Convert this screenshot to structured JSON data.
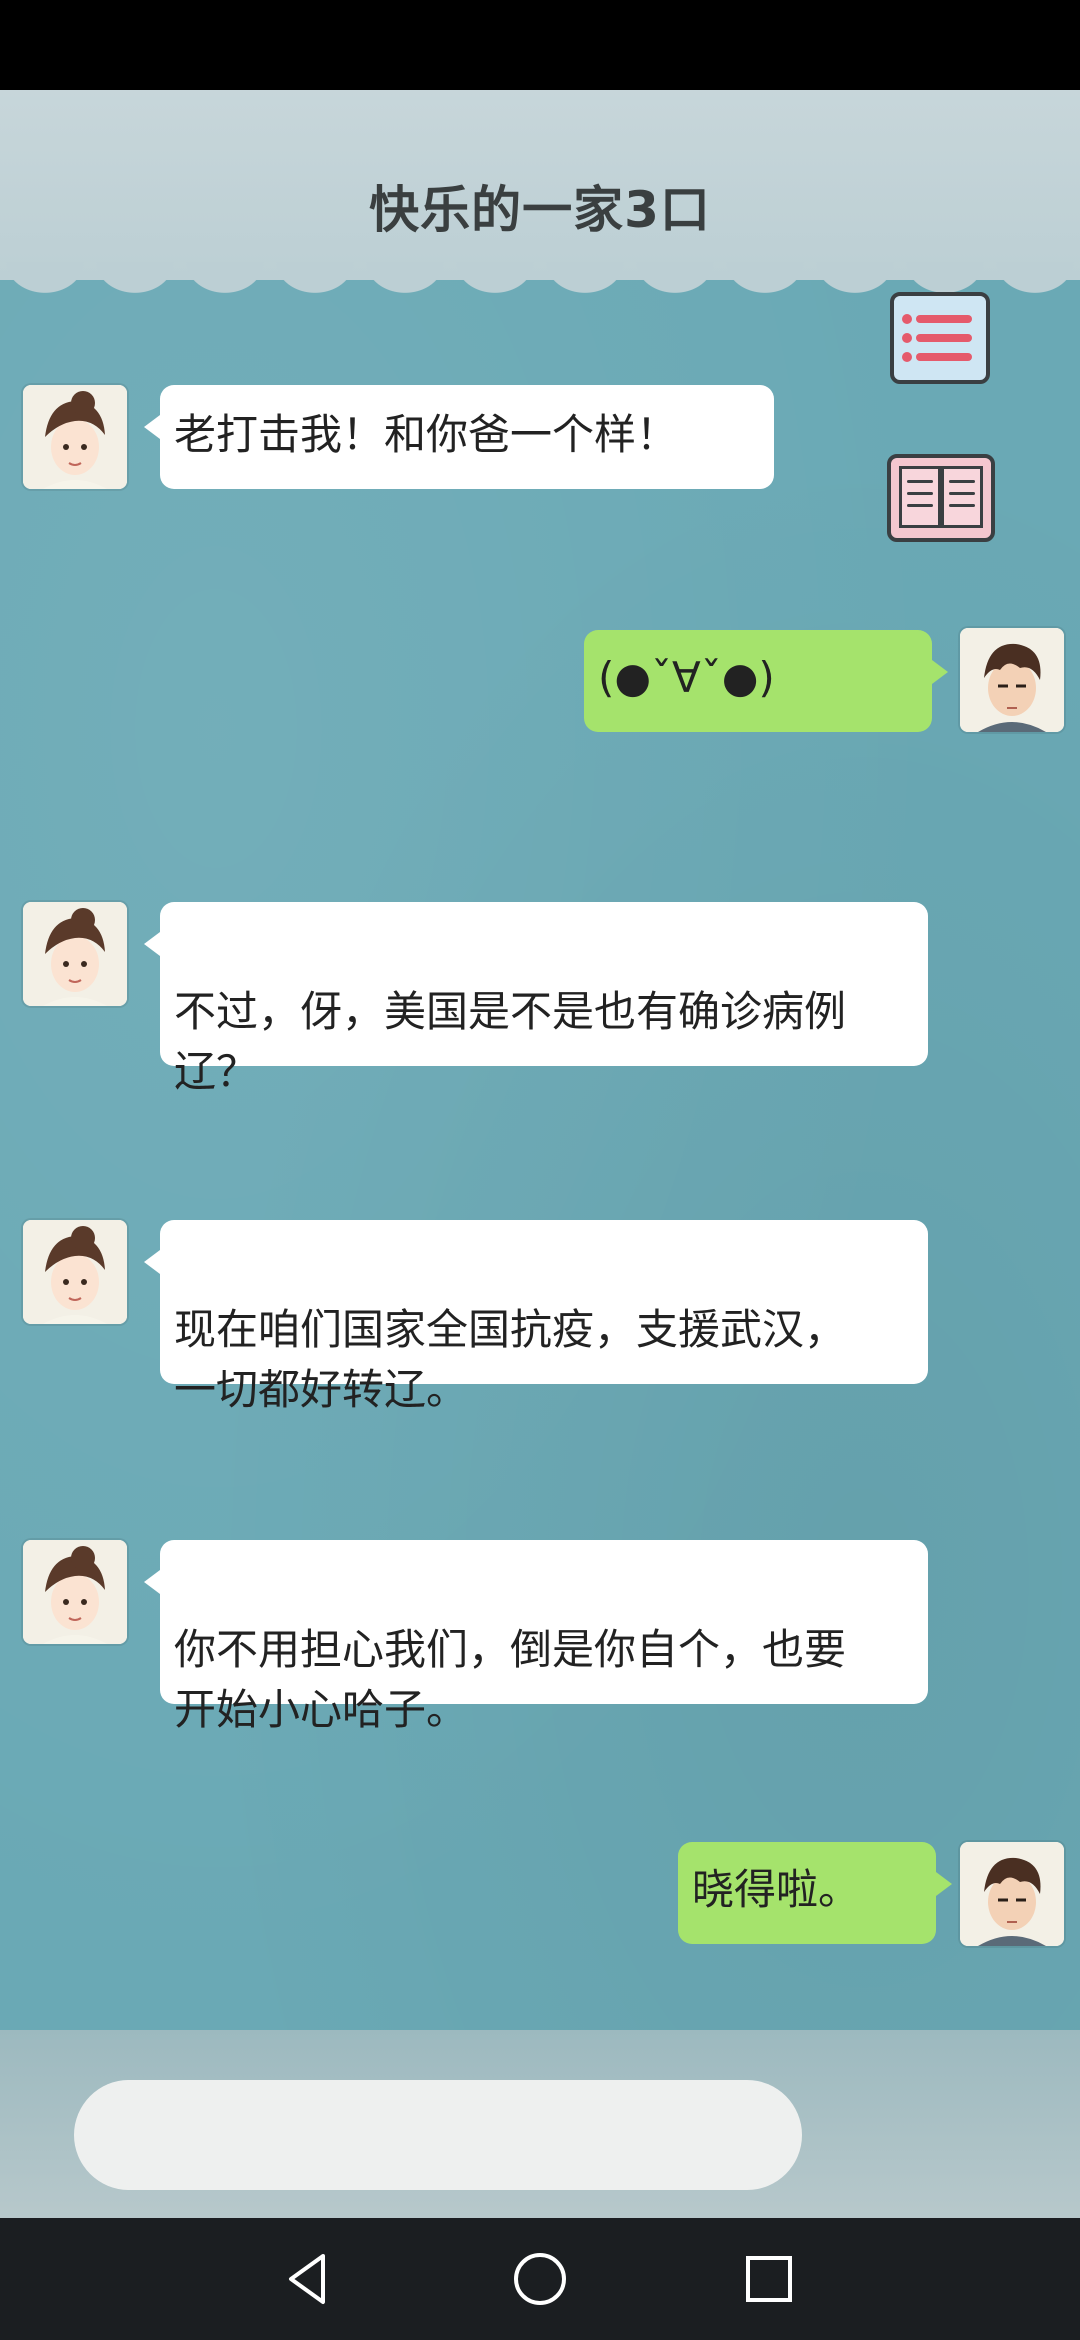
{
  "app": {
    "title": "快乐的一家3口",
    "icons": {
      "menu": "list-menu-icon",
      "book": "book-icon"
    }
  },
  "messages": [
    {
      "side": "left",
      "sender": "mom",
      "text": "老打击我！和你爸一个样！"
    },
    {
      "side": "right",
      "sender": "son",
      "text": "(●ˇ∀ˇ●)"
    },
    {
      "side": "left",
      "sender": "mom",
      "text": "不过，伢，美国是不是也有确诊病例\n辽？"
    },
    {
      "side": "left",
      "sender": "mom",
      "text": "现在咱们国家全国抗疫，支援武汉，\n一切都好转辽。"
    },
    {
      "side": "left",
      "sender": "mom",
      "text": "你不用担心我们，倒是你自个，也要\n开始小心哈子。"
    },
    {
      "side": "right",
      "sender": "son",
      "text": "晓得啦。"
    }
  ],
  "input": {
    "placeholder": ""
  },
  "nav": {
    "back": "back-triangle-icon",
    "home": "home-circle-icon",
    "recents": "recents-square-icon"
  },
  "colors": {
    "background": "#6aa9b5",
    "left_bubble": "#ffffff",
    "right_bubble": "#a5e36c"
  }
}
